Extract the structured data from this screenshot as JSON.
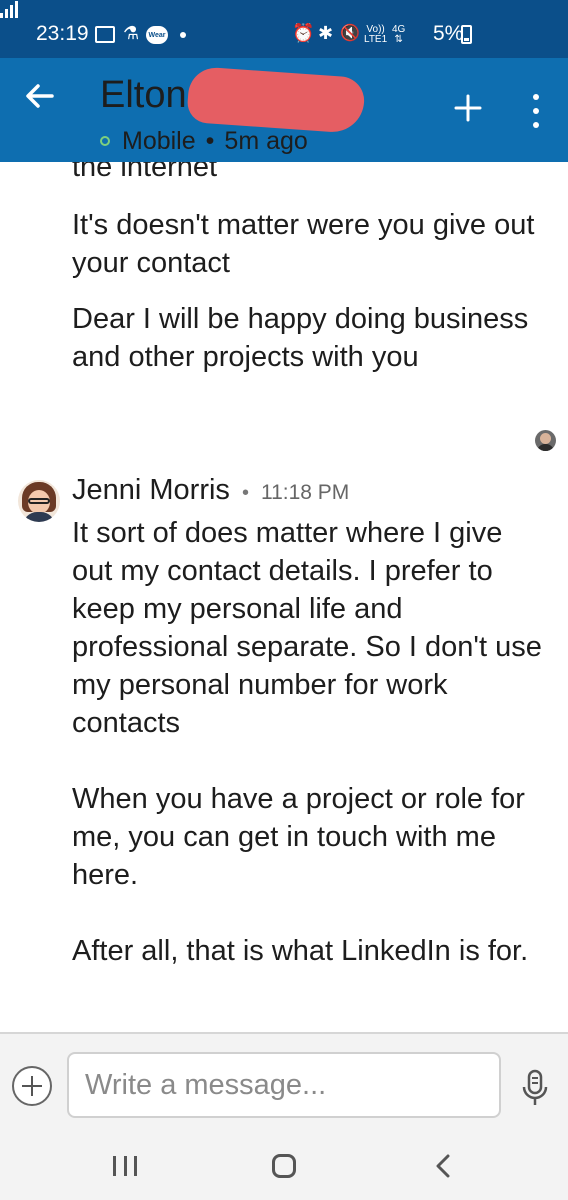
{
  "status_bar": {
    "time": "23:19",
    "wear_label": "Wear",
    "volte_line1": "Vo))",
    "volte_line2": "LTE1",
    "network_type": "4G",
    "battery_percent": "5%",
    "icons": [
      "gallery-icon",
      "accessibility-icon",
      "wear-icon",
      "notification-dot",
      "alarm-icon",
      "bluetooth-icon",
      "mute-icon",
      "volte-icon",
      "signal-icon",
      "battery-icon"
    ]
  },
  "header": {
    "contact_name": "Elton",
    "name_redacted": true,
    "presence_label": "Mobile",
    "presence_separator": "•",
    "last_seen": "5m ago",
    "colors": {
      "status_bar": "#0b4f8a",
      "app_bar": "#0e6eb0",
      "presence": "#7ed07e"
    }
  },
  "messages": [
    {
      "text": "the internet"
    },
    {
      "text": "It's doesn't matter were you give out your contact"
    },
    {
      "text": "Dear I will be happy doing business and other projects with you"
    }
  ],
  "reply": {
    "sender": "Jenni Morris",
    "separator": "•",
    "time": "11:18 PM",
    "text": "It sort of does matter where I give out my contact details. I prefer to keep my personal life and professional separate. So I don't use my personal number for work contacts\n\nWhen you have a project or role for me, you can get in touch with me here.\n\nAfter all, that is what LinkedIn is for."
  },
  "composer": {
    "placeholder": "Write a message...",
    "value": ""
  }
}
